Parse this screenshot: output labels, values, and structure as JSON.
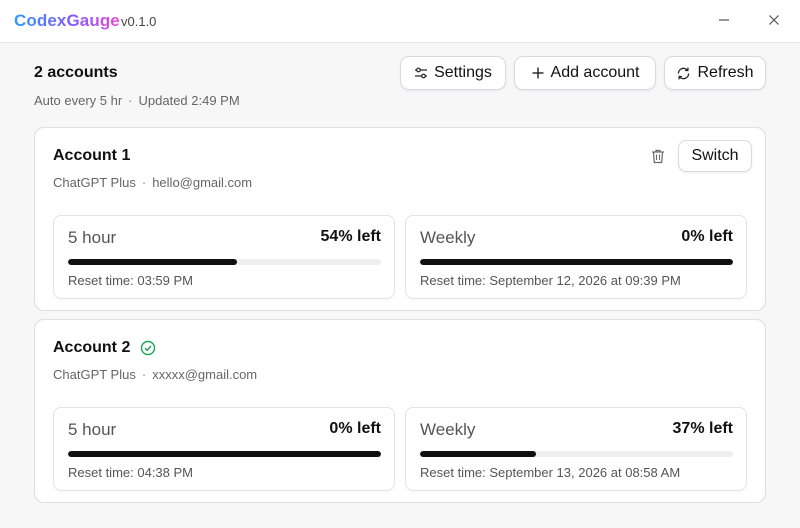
{
  "app": {
    "title": "CodexGauge",
    "version": "v0.1.0"
  },
  "window_controls": {
    "minimize_icon": "minimize-icon",
    "close_icon": "close-icon"
  },
  "header": {
    "accounts_count": "2 accounts",
    "auto_refresh": "Auto every 5 hr",
    "separator": "·",
    "updated": "Updated 2:49 PM"
  },
  "toolbar": {
    "settings_label": "Settings",
    "add_account_label": "Add account",
    "refresh_label": "Refresh"
  },
  "colors": {
    "brand_gradient": [
      "#2f9bff",
      "#7a5cff",
      "#e84bd8"
    ],
    "bar_fill": "#0f0f10",
    "bar_track": "#efeff1",
    "active_check": "#22a35a"
  },
  "accounts": [
    {
      "name": "Account 1",
      "active": false,
      "plan": "ChatGPT Plus",
      "separator": "·",
      "email": "hello@gmail.com",
      "switch_label": "Switch",
      "meters": [
        {
          "label": "5 hour",
          "value_text": "54% left",
          "percent_left": 54,
          "reset": "Reset time: 03:59 PM"
        },
        {
          "label": "Weekly",
          "value_text": "0% left",
          "percent_left": 100,
          "reset": "Reset time: September 12, 2026 at 09:39 PM"
        }
      ]
    },
    {
      "name": "Account 2",
      "active": true,
      "plan": "ChatGPT Plus",
      "separator": "·",
      "email": "xxxxx@gmail.com",
      "meters": [
        {
          "label": "5 hour",
          "value_text": "0% left",
          "percent_left": 100,
          "reset": "Reset time: 04:38 PM"
        },
        {
          "label": "Weekly",
          "value_text": "37% left",
          "percent_left": 37,
          "reset": "Reset time: September 13, 2026 at 08:58 AM"
        }
      ]
    }
  ]
}
